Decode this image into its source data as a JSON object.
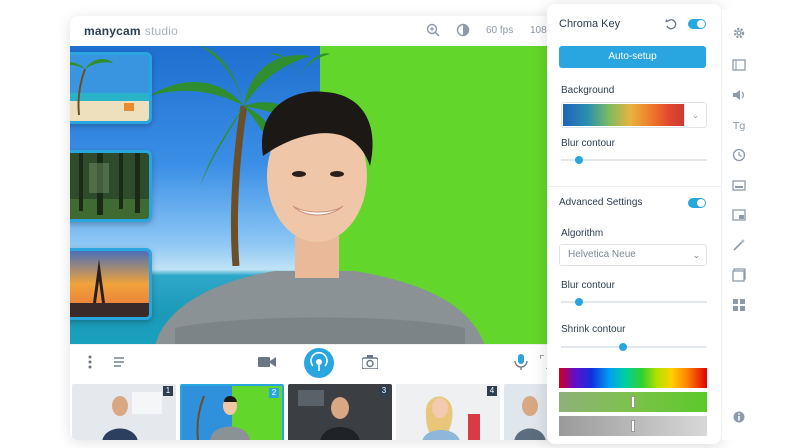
{
  "app": {
    "logo_bold": "manycam",
    "logo_light": "studio",
    "fps": "60 fps",
    "resolution": "108"
  },
  "icons": {
    "zoom": "zoom-in-icon",
    "contrast": "contrast-icon",
    "settings": "gear-icon"
  },
  "panel": {
    "title": "Chroma Key",
    "auto_setup": "Auto-setup",
    "background_label": "Background",
    "blur_contour_label": "Blur contour",
    "advanced_settings_label": "Advanced Settings",
    "algorithm_label": "Algorithm",
    "algorithm_value": "Helvetica Neue",
    "blur_contour_label_2": "Blur contour",
    "shrink_contour_label": "Shrink contour",
    "chroma_key_enabled": true,
    "advanced_enabled": true,
    "blur_contour_value": 0.1,
    "blur_contour_2_value": 0.1,
    "shrink_contour_value": 0.42
  },
  "bottom_thumbs": [
    {
      "num": "1",
      "active": false
    },
    {
      "num": "2",
      "active": true
    },
    {
      "num": "3",
      "active": false
    },
    {
      "num": "4",
      "active": false
    }
  ],
  "colors": {
    "accent": "#29a6e0",
    "chroma_green": "#63d62b"
  }
}
